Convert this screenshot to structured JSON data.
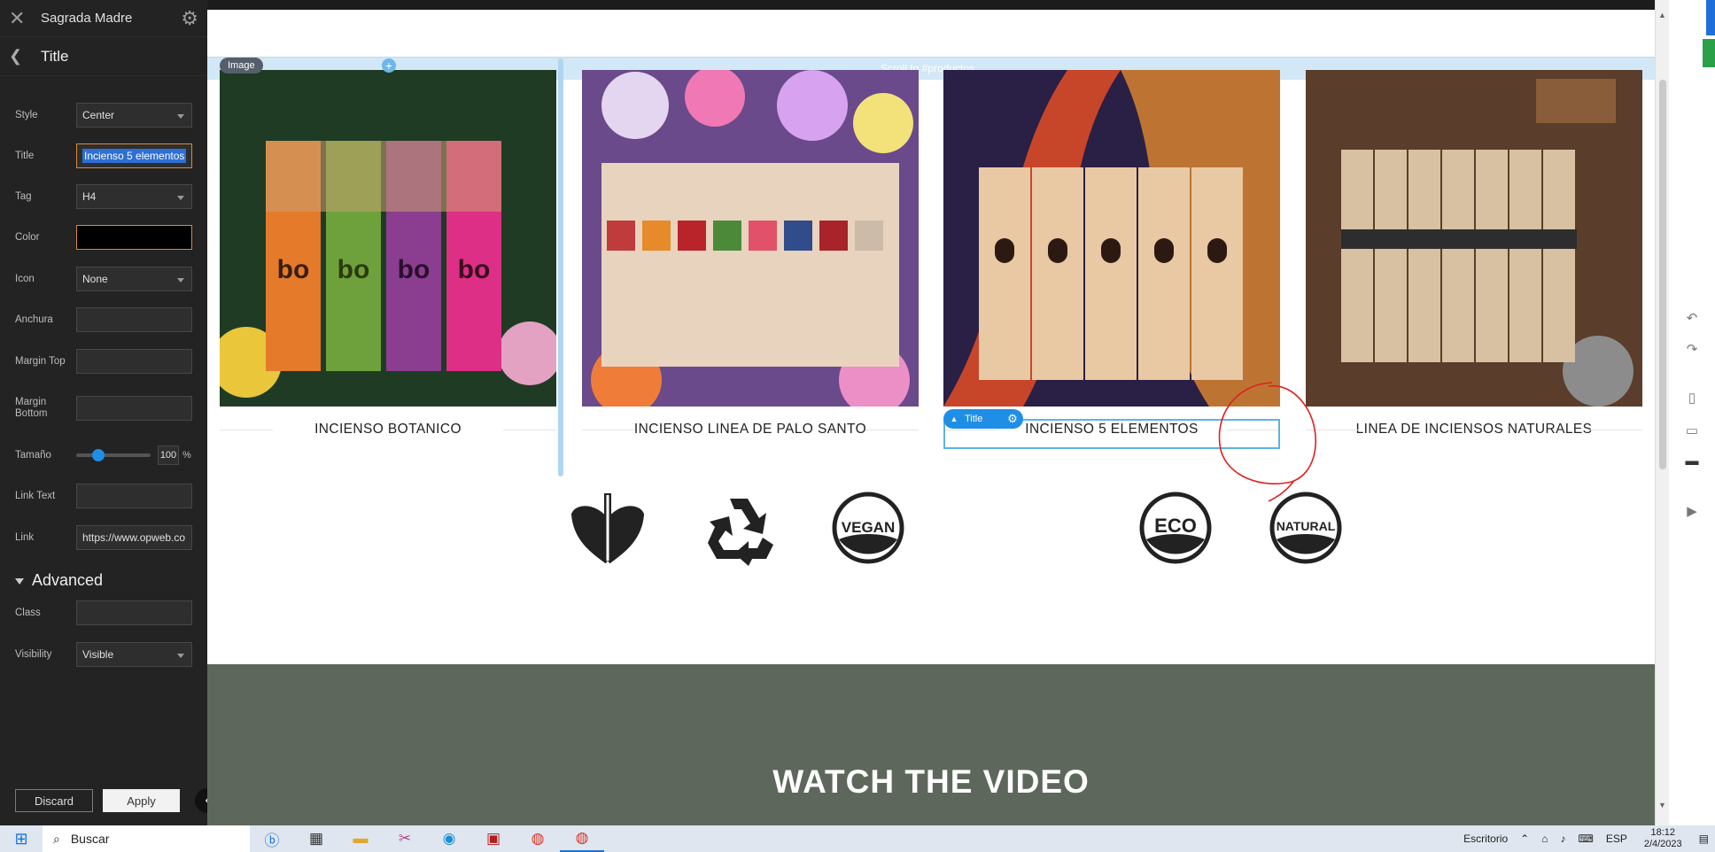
{
  "editor": {
    "site_name": "Sagrada Madre",
    "panel_title": "Title",
    "fields": {
      "style": {
        "label": "Style",
        "value": "Center"
      },
      "title": {
        "label": "Title",
        "value": "Incienso 5 elementos"
      },
      "tag": {
        "label": "Tag",
        "value": "H4"
      },
      "color": {
        "label": "Color",
        "value": "#000000"
      },
      "icon": {
        "label": "Icon",
        "value": "None"
      },
      "anchura": {
        "label": "Anchura",
        "value": ""
      },
      "margin_top": {
        "label": "Margin Top",
        "value": ""
      },
      "margin_bottom": {
        "label": "Margin Bottom",
        "value": ""
      },
      "tamano": {
        "label": "Tamaño",
        "value": "100",
        "unit": "%",
        "slider_fraction": 0.25
      },
      "link_text": {
        "label": "Link Text",
        "value": ""
      },
      "link": {
        "label": "Link",
        "value": "https://www.opweb.co"
      }
    },
    "advanced": {
      "label": "Advanced",
      "class": {
        "label": "Class",
        "value": ""
      },
      "visibility": {
        "label": "Visibility",
        "value": "Visible"
      }
    },
    "discard_label": "Discard",
    "apply_label": "Apply"
  },
  "canvas": {
    "image_badge": "Image",
    "scroll_to": "Scroll to #productos",
    "selected_widget": "Title",
    "products": [
      {
        "title": "INCIENSO BOTANICO"
      },
      {
        "title": "INCIENSO LINEA DE PALO SANTO"
      },
      {
        "title": "INCIENSO 5 ELEMENTOS"
      },
      {
        "title": "LINEA DE INCIENSOS NATURALES"
      }
    ],
    "badges": [
      {
        "name": "leaf",
        "text": ""
      },
      {
        "name": "recycle",
        "text": ""
      },
      {
        "name": "vegan",
        "text": "VEGAN"
      },
      {
        "name": "eco",
        "text": "ECO"
      },
      {
        "name": "natural",
        "text": "NATURAL"
      }
    ],
    "video_title": "WATCH THE VIDEO"
  },
  "taskbar": {
    "search_placeholder": "Buscar",
    "desktop_label": "Escritorio",
    "language": "ESP",
    "time": "18:12",
    "date": "2/4/2023"
  },
  "colors": {
    "panel_bg": "#232323",
    "accent": "#1f8ee6",
    "video_band": "#5d675b"
  }
}
